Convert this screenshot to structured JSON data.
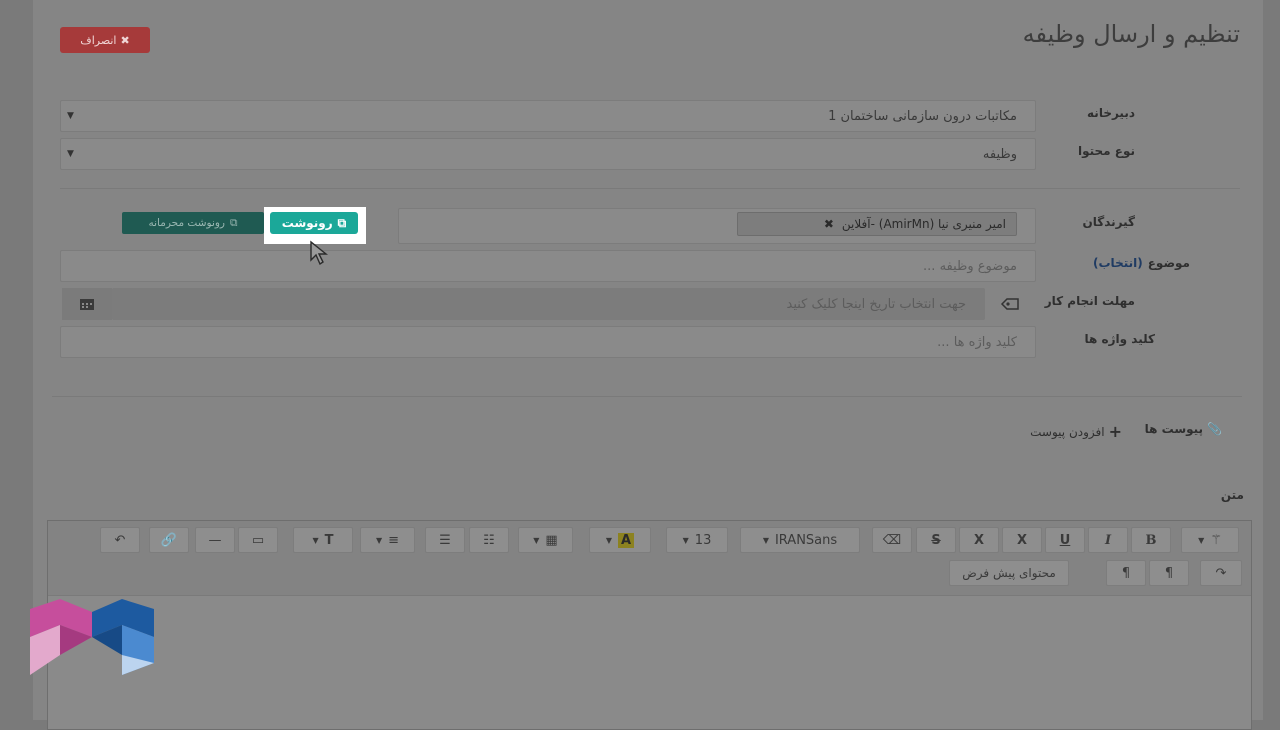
{
  "header": {
    "title": "تنظیم و ارسال وظیفه",
    "cancel_label": "انصراف"
  },
  "form": {
    "secretariat": {
      "label": "دبیرخانه",
      "value": "مکاتبات درون سازمانی ساختمان 1"
    },
    "content_type": {
      "label": "نوع محتوا",
      "value": "وظیفه"
    },
    "recipients": {
      "label": "گیرندگان",
      "tag": "امیر منیری نیا (AmirMn) -آفلاین",
      "copy_label": "رونوشت",
      "secret_copy_label": "رونوشت محرمانه"
    },
    "subject": {
      "label": "موضوع",
      "pick_label": "(انتخاب)",
      "placeholder": "موضوع وظیفه ..."
    },
    "deadline": {
      "label": "مهلت انجام کار",
      "placeholder": "جهت انتخاب تاریخ اینجا کلیک کنید"
    },
    "keywords": {
      "label": "کلید واژه ها",
      "placeholder": "کلید واژه ها ..."
    }
  },
  "attachments": {
    "label": "پیوست ها",
    "add_label": "افزودن پیوست"
  },
  "text_section": {
    "label": "متن"
  },
  "editor": {
    "font_size": "13",
    "font_family": "IRANSans",
    "default_content_label": "محتوای پیش فرض",
    "bold": "B",
    "italic": "I",
    "underline": "U",
    "superscript": "X",
    "subscript": "X",
    "strike": "S",
    "font_color": "A",
    "text_size": "T"
  },
  "colors": {
    "copy_button": "#1ba899",
    "secret_copy": "#1f5a52",
    "cancel": "#a63a3a",
    "link": "#1f3b63"
  }
}
